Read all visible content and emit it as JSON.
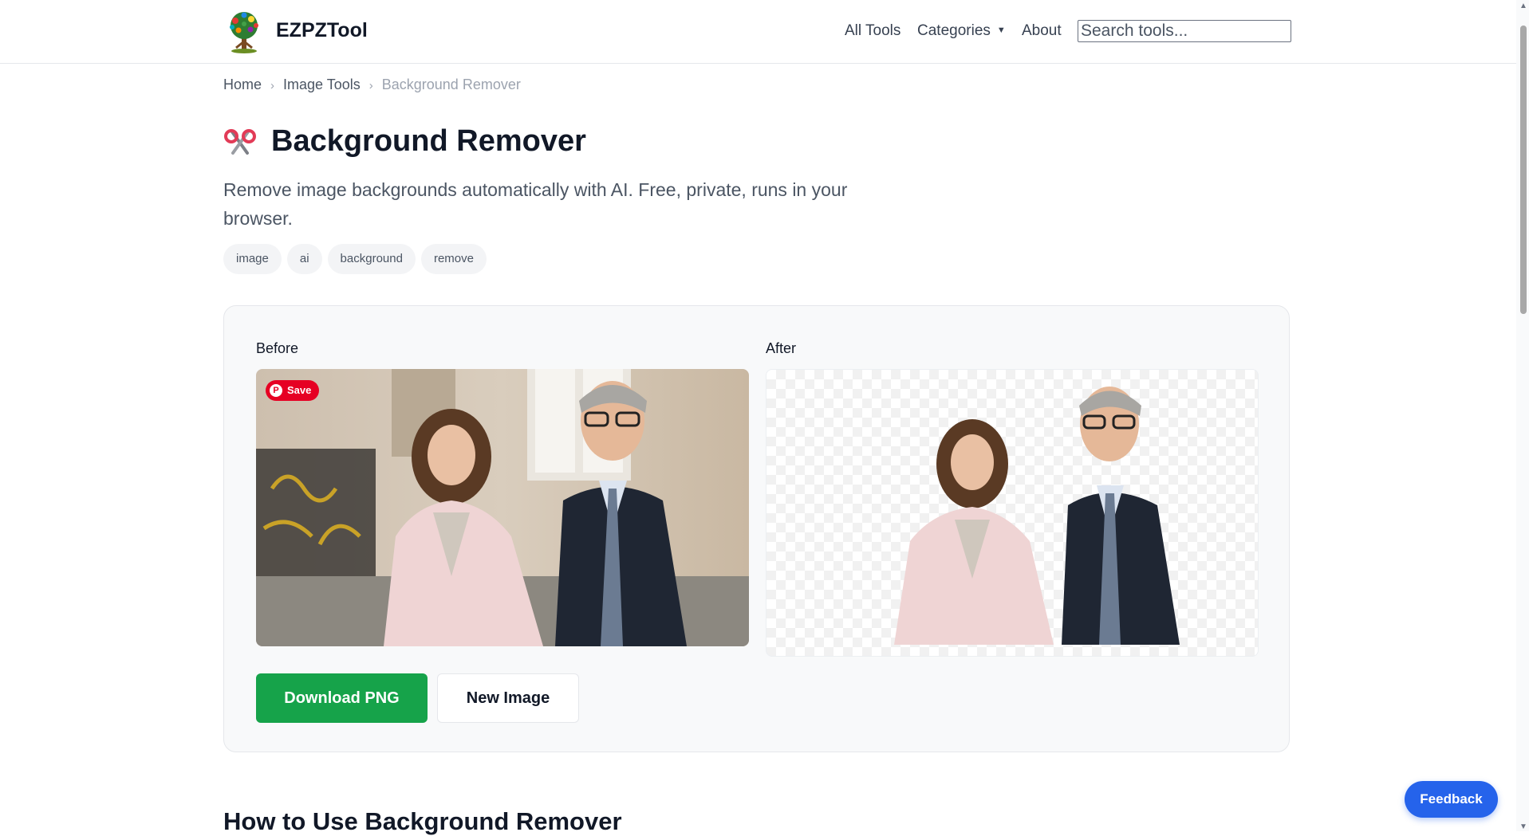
{
  "header": {
    "brand": "EZPZTool",
    "nav": {
      "all_tools": "All Tools",
      "categories": "Categories",
      "about": "About"
    },
    "search_placeholder": "Search tools..."
  },
  "breadcrumb": {
    "home": "Home",
    "section": "Image Tools",
    "current": "Background Remover"
  },
  "page": {
    "title": "Background Remover",
    "title_icon": "scissors-icon",
    "description": "Remove image backgrounds automatically with AI. Free, private, runs in your browser.",
    "tags": [
      "image",
      "ai",
      "background",
      "remove"
    ]
  },
  "tool": {
    "before_label": "Before",
    "after_label": "After",
    "save_badge": "Save",
    "download_label": "Download PNG",
    "new_image_label": "New Image"
  },
  "howto_heading": "How to Use Background Remover",
  "feedback_label": "Feedback",
  "colors": {
    "primary_green": "#16a34a",
    "feedback_blue": "#2563eb",
    "pinterest_red": "#e60023"
  }
}
